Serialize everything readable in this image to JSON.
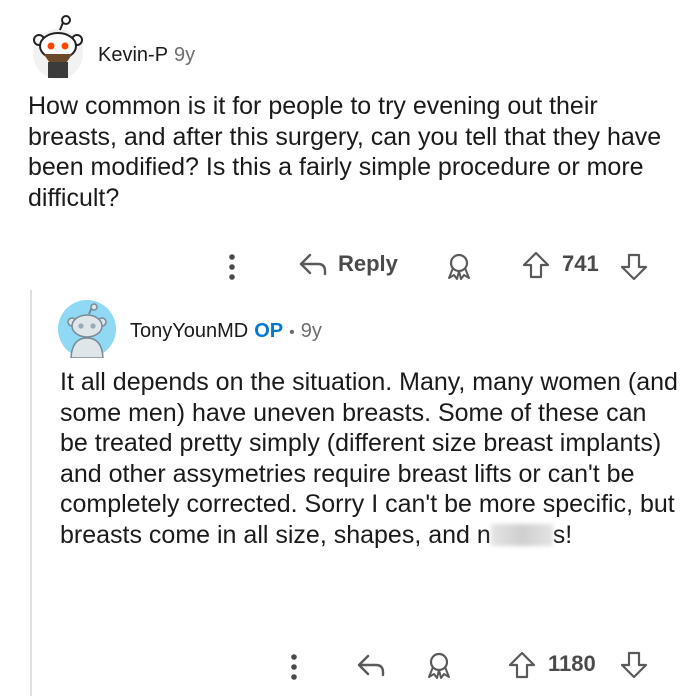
{
  "comments": [
    {
      "author": "Kevin-P",
      "age": "9y",
      "body": "How common is it for people to try evening out their breasts, and after this surgery, can you tell that they have been modified? Is this a fairly simple procedure or more difficult?",
      "reply_label": "Reply",
      "votes": "741",
      "icons": [
        "more-dots-icon",
        "reply-arrow-icon",
        "award-icon",
        "upvote-icon",
        "downvote-icon"
      ]
    },
    {
      "author": "TonyYounMD",
      "badge": "OP",
      "separator": "•",
      "age": "9y",
      "body_main": "It all depends on the situation. Many, many women (and some men) have uneven breasts. Some of these can be treated pretty simply (different size breast implants) and other assymetries require breast lifts or can't be completely corrected. Sorry I can't be more specific, but breasts come in all size, shapes, and",
      "body_tail_start": "n",
      "body_tail_end": "s!",
      "votes": "1180",
      "icons": [
        "more-dots-icon",
        "reply-arrow-icon",
        "award-icon",
        "upvote-icon",
        "downvote-icon"
      ]
    }
  ],
  "colors": {
    "text": "#1a1a1b",
    "muted": "#6b6b6b",
    "op_badge": "#0079d3",
    "thread_line": "#e0e0e0",
    "avatar_tony_bg": "#8fd9f5"
  }
}
